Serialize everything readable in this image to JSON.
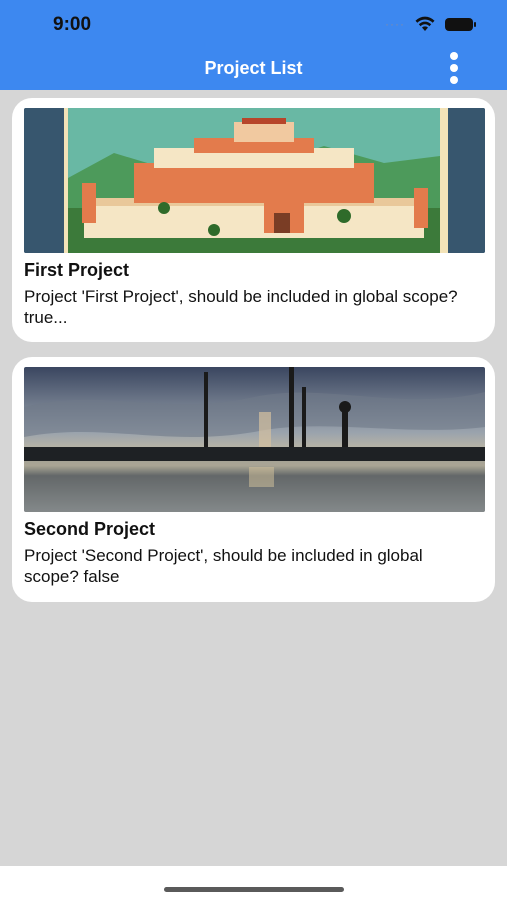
{
  "status_bar": {
    "time": "9:00",
    "signal_icon": "signal-dots-icon",
    "wifi_icon": "wifi-icon",
    "battery_icon": "battery-icon"
  },
  "app_bar": {
    "title": "Project List",
    "menu_icon": "more-vertical-icon",
    "color": "#3d88f0"
  },
  "projects": [
    {
      "name": "First Project",
      "description": "Project 'First Project', should be included in global scope? true..."
    },
    {
      "name": "Second Project",
      "description": "Project 'Second Project', should be included in global scope? false"
    }
  ],
  "colors": {
    "background": "#d6d6d6",
    "card": "#ffffff"
  }
}
